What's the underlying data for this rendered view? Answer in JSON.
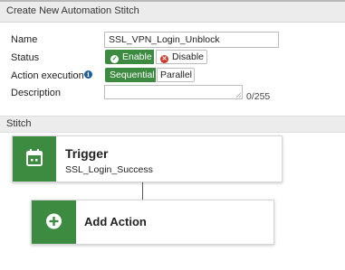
{
  "window": {
    "title": "Create New Automation Stitch"
  },
  "form": {
    "name_label": "Name",
    "name_value": "SSL_VPN_Login_Unblock",
    "status_label": "Status",
    "status_enable": "Enable",
    "status_disable": "Disable",
    "status_selected": "Enable",
    "action_execution_label": "Action execution",
    "exec_sequential": "Sequential",
    "exec_parallel": "Parallel",
    "exec_selected": "Sequential",
    "description_label": "Description",
    "description_value": "",
    "description_counter": "0/255"
  },
  "stitch": {
    "section_label": "Stitch",
    "trigger": {
      "title": "Trigger",
      "name": "SSL_Login_Success",
      "icon": "calendar-icon"
    },
    "action": {
      "title": "Add Action",
      "icon": "plus-circle-icon"
    }
  },
  "colors": {
    "accent_green": "#3d8b40",
    "info_blue": "#1b5d9b",
    "disable_red": "#d0392b"
  }
}
